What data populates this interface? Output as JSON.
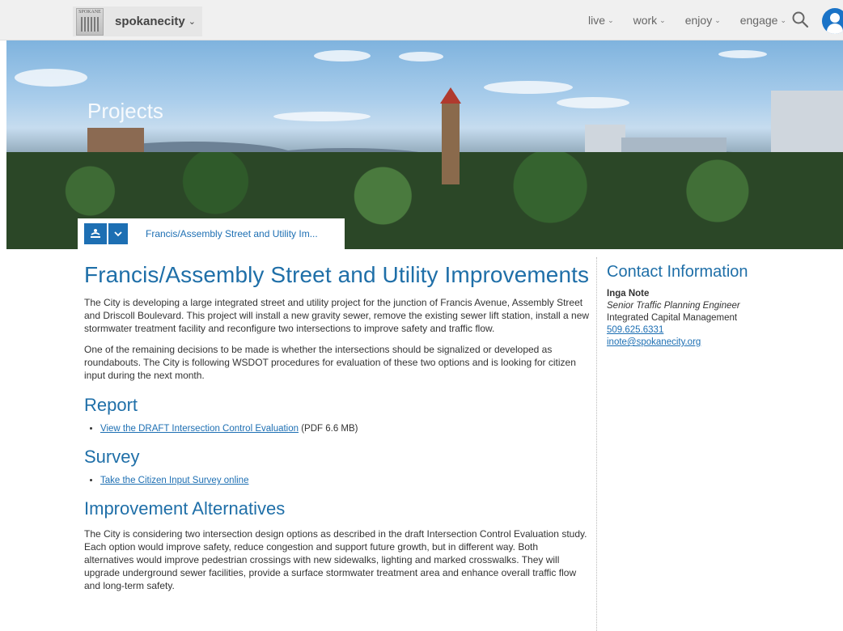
{
  "nav": {
    "seal_text": "SPOKANE",
    "brand": "spokanecity",
    "brand_caret": "⌄",
    "items": [
      {
        "label": "live",
        "caret": "⌄"
      },
      {
        "label": "work",
        "caret": "⌄"
      },
      {
        "label": "enjoy",
        "caret": "⌄"
      },
      {
        "label": "engage",
        "caret": "⌄"
      }
    ],
    "search_icon": "search-icon",
    "avatar_icon": "user-avatar-icon"
  },
  "hero": {
    "title": "Projects"
  },
  "breadcrumb": {
    "home_icon": "fountain-icon",
    "toggle_icon": "chevron-down-icon",
    "current": "Francis/Assembly Street and Utility Im..."
  },
  "main": {
    "title": "Francis/Assembly Street and Utility Improvements",
    "intro_1": "The City is developing a large integrated street and utility project for the junction of Francis Avenue, Assembly Street and Driscoll Boulevard. This project will install a new gravity sewer, remove the existing sewer lift station, install a new stormwater treatment facility and reconfigure two intersections to improve safety and traffic flow.",
    "intro_2": "One of the remaining decisions to be made is whether the intersections should be signalized or developed as roundabouts. The City is following WSDOT procedures for evaluation of these two options and is looking for citizen input during the next month.",
    "report": {
      "heading": "Report",
      "link": "View the DRAFT Intersection Control Evaluation",
      "suffix": " (PDF 6.6 MB)"
    },
    "survey": {
      "heading": "Survey",
      "link": "Take the Citizen Input Survey online"
    },
    "alternatives": {
      "heading": "Improvement Alternatives",
      "text": "The City is considering two intersection design options as described in the draft Intersection Control Evaluation study. Each option would improve safety, reduce congestion and support future growth, but in different way. Both alternatives would improve pedestrian crossings with new sidewalks, lighting and marked crosswalks. They will upgrade underground sewer facilities, provide a surface stormwater treatment area and enhance overall traffic flow and long-term safety."
    }
  },
  "sidebar": {
    "title": "Contact Information",
    "name": "Inga Note",
    "role": "Senior Traffic Planning Engineer",
    "dept": "Integrated Capital Management",
    "phone": "509.625.6331",
    "email": "inote@spokanecity.org"
  }
}
